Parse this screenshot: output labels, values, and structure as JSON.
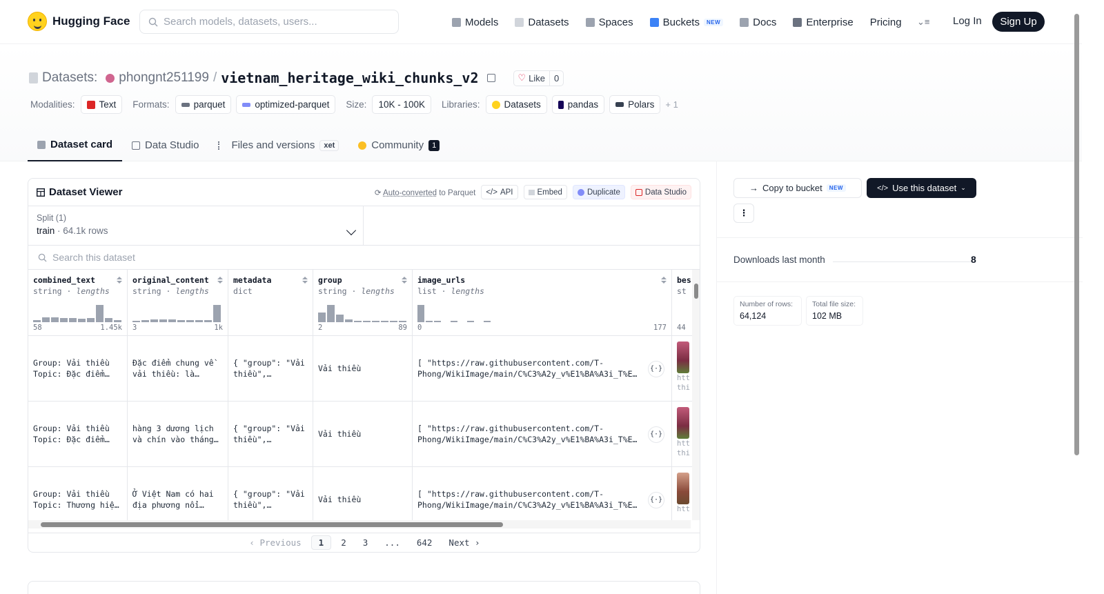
{
  "brand": {
    "name": "Hugging Face"
  },
  "nav": {
    "search_placeholder": "Search models, datasets, users...",
    "links": [
      {
        "label": "Models",
        "icon": "models-icon",
        "color": "#9ca3af"
      },
      {
        "label": "Datasets",
        "icon": "datasets-icon",
        "color": "#d1d5db"
      },
      {
        "label": "Spaces",
        "icon": "spaces-icon",
        "color": "#9ca3af"
      },
      {
        "label": "Buckets",
        "icon": "buckets-icon",
        "color": "#3b82f6",
        "badge": "NEW"
      },
      {
        "label": "Docs",
        "icon": "docs-icon",
        "color": "#9ca3af"
      },
      {
        "label": "Enterprise",
        "icon": "enterprise-icon",
        "color": "#6b7280"
      },
      {
        "label": "Pricing"
      }
    ],
    "login": "Log In",
    "signup": "Sign Up"
  },
  "header": {
    "label": "Datasets:",
    "user": "phongnt251199",
    "repo": "vietnam_heritage_wiki_chunks_v2",
    "like_label": "Like",
    "like_count": "0"
  },
  "meta": {
    "modalities_label": "Modalities:",
    "modality": "Text",
    "formats_label": "Formats:",
    "formats": [
      "parquet",
      "optimized-parquet"
    ],
    "size_label": "Size:",
    "size": "10K - 100K",
    "libraries_label": "Libraries:",
    "libraries": [
      "Datasets",
      "pandas",
      "Polars"
    ],
    "more": "+ 1"
  },
  "tabs": [
    {
      "label": "Dataset card",
      "active": true
    },
    {
      "label": "Data Studio"
    },
    {
      "label": "Files and versions",
      "badge": "xet"
    },
    {
      "label": "Community",
      "count": "1"
    }
  ],
  "viewer": {
    "title": "Dataset Viewer",
    "auto_converted": "Auto-converted",
    "to_parquet": " to Parquet",
    "api": "API",
    "embed": "Embed",
    "duplicate": "Duplicate",
    "data_studio": "Data Studio",
    "split_label": "Split (1)",
    "split_name": "train",
    "split_rows": "64.1k rows",
    "search_placeholder": "Search this dataset",
    "columns": [
      {
        "name": "combined_text",
        "type": "string",
        "sub": "lengths",
        "min": "58",
        "max": "1.45k",
        "hist": [
          0.1,
          0.25,
          0.25,
          0.22,
          0.2,
          0.18,
          0.2,
          0.9,
          0.2,
          0.1
        ]
      },
      {
        "name": "original_content",
        "type": "string",
        "sub": "lengths",
        "min": "3",
        "max": "1k",
        "hist": [
          0.05,
          0.1,
          0.15,
          0.15,
          0.15,
          0.12,
          0.12,
          0.12,
          0.12,
          0.9
        ]
      },
      {
        "name": "metadata",
        "type": "dict",
        "sub": "",
        "min": "",
        "max": "",
        "hist": []
      },
      {
        "name": "group",
        "type": "string",
        "sub": "lengths",
        "min": "2",
        "max": "89",
        "hist": [
          0.5,
          0.9,
          0.4,
          0.15,
          0.08,
          0.05,
          0.05,
          0.05,
          0.03,
          0.03
        ]
      },
      {
        "name": "image_urls",
        "type": "list",
        "sub": "lengths",
        "min": "0",
        "max": "177",
        "hist": [
          0.9,
          0.05,
          0.03,
          0,
          0.03,
          0,
          0.02,
          0,
          0.02,
          0
        ]
      },
      {
        "name": "bes",
        "type": "st",
        "sub": "",
        "min": "44",
        "max": "",
        "hist": []
      }
    ],
    "rows": [
      {
        "combined_text": [
          "Group: Vải thiều",
          "Topic: Đặc điểm…"
        ],
        "original_content": [
          "Đặc điểm chung về",
          "vải thiều: là…"
        ],
        "metadata": [
          "{ \"group\": \"Vải",
          "thiều\",…"
        ],
        "group": "Vải thiều",
        "image_urls": [
          "[ \"https://raw.githubusercontent.com/T-",
          "Phong/WikiImage/main/C%C3%A2y_v%E1%BA%A3i_T%E…"
        ],
        "last": [
          "htt",
          "thi"
        ]
      },
      {
        "combined_text": [
          "Group: Vải thiều",
          "Topic: Đặc điểm…"
        ],
        "original_content": [
          "hàng 3 dương lịch",
          "và chín vào tháng…"
        ],
        "metadata": [
          "{ \"group\": \"Vải",
          "thiều\",…"
        ],
        "group": "Vải thiều",
        "image_urls": [
          "[ \"https://raw.githubusercontent.com/T-",
          "Phong/WikiImage/main/C%C3%A2y_v%E1%BA%A3i_T%E…"
        ],
        "last": [
          "htt",
          "thi"
        ]
      },
      {
        "combined_text": [
          "Group: Vải thiều",
          "Topic: Thương hiệ…"
        ],
        "original_content": [
          "Ở Việt Nam có hai",
          "địa phương nổi…"
        ],
        "metadata": [
          "{ \"group\": \"Vải",
          "thiều\",…"
        ],
        "group": "Vải thiều",
        "image_urls": [
          "[ \"https://raw.githubusercontent.com/T-",
          "Phong/WikiImage/main/C%C3%A2y_v%E1%BA%A3i_T%E…"
        ],
        "last": [
          "htt",
          ""
        ]
      }
    ],
    "pager": {
      "prev": "Previous",
      "pages": [
        "1",
        "2",
        "3",
        "...",
        "642"
      ],
      "next": "Next"
    }
  },
  "sidebar": {
    "copy_bucket": "Copy to bucket",
    "copy_badge": "NEW",
    "use_dataset": "Use this dataset",
    "downloads_label": "Downloads last month",
    "downloads": "8",
    "rows_label": "Number of rows:",
    "rows": "64,124",
    "size_label": "Total file size:",
    "size": "102 MB"
  }
}
